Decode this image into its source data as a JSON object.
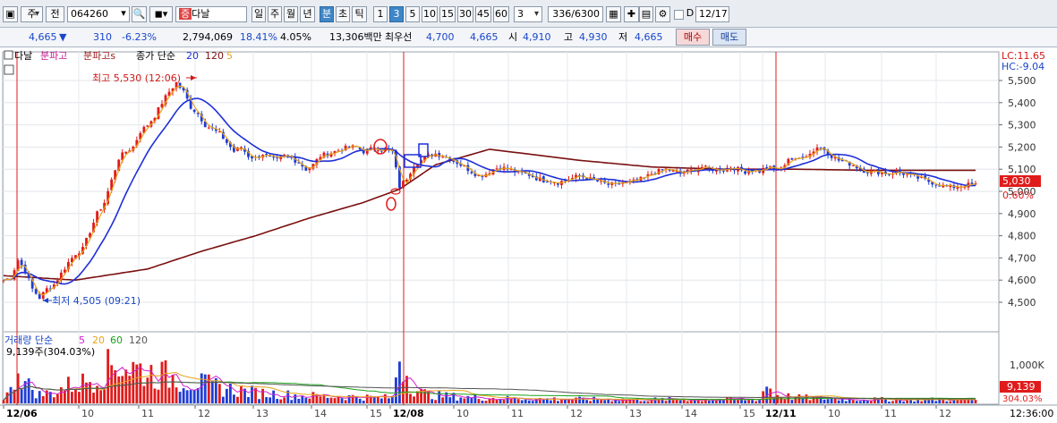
{
  "toolbar": {
    "market_label": "주",
    "prev_label": "전",
    "code": "064260",
    "stock_name": "다날",
    "name_badge": "증",
    "period_buttons": [
      "일",
      "주",
      "월",
      "년",
      "분",
      "초",
      "틱"
    ],
    "interval_buttons": [
      "1",
      "3",
      "5",
      "10",
      "15",
      "30",
      "45",
      "60"
    ],
    "interval_select": "3",
    "count_display": "336/6300",
    "date_checkbox_label": "D",
    "date": "12/17"
  },
  "quote": {
    "price": "4,665",
    "change_arrow": "▼",
    "change": "310",
    "change_pct": "-6.23%",
    "volume": "2,794,069",
    "vol_ratio": "18.41%",
    "turnover": "4.05%",
    "amount": "13,306백만",
    "best_label": "최우선",
    "ask": "4,700",
    "bid": "4,665",
    "open_label": "시",
    "open": "4,910",
    "high_label": "고",
    "high": "4,930",
    "low_label": "저",
    "low": "4,665",
    "buy_label": "매수",
    "sell_label": "매도"
  },
  "legend": {
    "item1": "다날",
    "item2": "분파고",
    "item3": "분파고s",
    "ma_label": "종가 단순",
    "ma_periods": [
      "20",
      "120",
      "5"
    ],
    "lc_label": "LC:11.65",
    "hc_label": "HC:-9.04",
    "vol_title": "거래량 단순",
    "vol_periods": [
      "5",
      "20",
      "60",
      "120"
    ],
    "vol_current": "9,139주(304.03%)"
  },
  "annotations": {
    "high": "최고 5,530 (12:06)",
    "low": "최저 4,505 (09:21)"
  },
  "colors": {
    "up": "#e01b1b",
    "down": "#1f3cd4",
    "ma5": "#e8a317",
    "ma20": "#1e2fd8",
    "ma120": "#7a1010",
    "vol_ma5": "#d020d0",
    "vol_ma20": "#e8a317",
    "vol_ma60": "#1aa01a",
    "vol_ma120": "#555555",
    "accent_toolbar": "#3f86c7"
  },
  "chart_data": {
    "type": "candlestick",
    "interval": "3분",
    "y_ticks": [
      "5,500",
      "5,400",
      "5,300",
      "5,200",
      "5,100",
      "5,000",
      "4,900",
      "4,800",
      "4,700",
      "4,600",
      "4,500"
    ],
    "ylim": [
      4440,
      5590
    ],
    "price_tag": "5,030",
    "price_tag_pct": "0.60%",
    "volume_tick": "1,000K",
    "volume_tag": "9,139",
    "volume_tag_pct": "304.03%",
    "time_label": "12:36:00",
    "x_labels": [
      "12/06",
      "10",
      "11",
      "12",
      "13",
      "14",
      "15",
      "12/08",
      "10",
      "11",
      "12",
      "13",
      "14",
      "15",
      "12/11",
      "10",
      "11",
      "12"
    ],
    "x_label_hours": [
      9,
      10,
      11,
      12,
      13,
      14,
      15,
      9,
      10,
      11,
      12,
      13,
      14,
      15,
      9,
      10,
      11,
      12
    ],
    "date_boundaries": [
      "12/06",
      "12/08",
      "12/11"
    ],
    "series": [
      {
        "name": "5",
        "indicator": "ma5"
      },
      {
        "name": "20",
        "indicator": "ma20"
      },
      {
        "name": "120",
        "indicator": "ma120"
      }
    ],
    "close_path": [
      [
        0,
        4600
      ],
      [
        2,
        4610
      ],
      [
        4,
        4690
      ],
      [
        6,
        4640
      ],
      [
        8,
        4560
      ],
      [
        10,
        4520
      ],
      [
        12,
        4560
      ],
      [
        14,
        4580
      ],
      [
        16,
        4630
      ],
      [
        18,
        4680
      ],
      [
        20,
        4720
      ],
      [
        22,
        4740
      ],
      [
        24,
        4820
      ],
      [
        26,
        4900
      ],
      [
        28,
        4950
      ],
      [
        30,
        5050
      ],
      [
        32,
        5150
      ],
      [
        34,
        5180
      ],
      [
        36,
        5200
      ],
      [
        38,
        5270
      ],
      [
        40,
        5300
      ],
      [
        42,
        5340
      ],
      [
        44,
        5400
      ],
      [
        46,
        5450
      ],
      [
        48,
        5490
      ],
      [
        50,
        5450
      ],
      [
        52,
        5380
      ],
      [
        54,
        5350
      ],
      [
        56,
        5300
      ],
      [
        58,
        5280
      ],
      [
        60,
        5260
      ],
      [
        62,
        5220
      ],
      [
        64,
        5180
      ],
      [
        66,
        5200
      ],
      [
        68,
        5160
      ],
      [
        70,
        5150
      ],
      [
        72,
        5170
      ],
      [
        74,
        5150
      ],
      [
        76,
        5140
      ],
      [
        78,
        5160
      ],
      [
        80,
        5150
      ],
      [
        82,
        5130
      ],
      [
        84,
        5100
      ],
      [
        86,
        5120
      ],
      [
        88,
        5160
      ],
      [
        90,
        5170
      ],
      [
        92,
        5180
      ],
      [
        94,
        5190
      ],
      [
        96,
        5200
      ],
      [
        98,
        5200
      ],
      [
        100,
        5180
      ],
      [
        102,
        5190
      ],
      [
        104,
        5195
      ],
      [
        106,
        5185
      ],
      [
        108,
        5180
      ],
      [
        110,
        5020
      ],
      [
        112,
        5060
      ],
      [
        114,
        5120
      ],
      [
        116,
        5140
      ],
      [
        118,
        5160
      ],
      [
        120,
        5170
      ],
      [
        122,
        5160
      ],
      [
        124,
        5150
      ],
      [
        126,
        5130
      ],
      [
        128,
        5110
      ],
      [
        130,
        5090
      ],
      [
        132,
        5070
      ],
      [
        134,
        5080
      ],
      [
        136,
        5100
      ],
      [
        138,
        5110
      ],
      [
        140,
        5100
      ],
      [
        142,
        5090
      ],
      [
        144,
        5080
      ],
      [
        146,
        5075
      ],
      [
        148,
        5060
      ],
      [
        150,
        5050
      ],
      [
        152,
        5050
      ],
      [
        154,
        5040
      ],
      [
        156,
        5050
      ],
      [
        158,
        5060
      ],
      [
        160,
        5070
      ],
      [
        162,
        5060
      ],
      [
        164,
        5050
      ],
      [
        166,
        5040
      ],
      [
        168,
        5030
      ],
      [
        170,
        5030
      ],
      [
        172,
        5040
      ],
      [
        174,
        5040
      ],
      [
        176,
        5050
      ],
      [
        178,
        5060
      ],
      [
        180,
        5080
      ],
      [
        182,
        5090
      ],
      [
        184,
        5100
      ],
      [
        186,
        5090
      ],
      [
        188,
        5080
      ],
      [
        190,
        5090
      ],
      [
        192,
        5100
      ],
      [
        194,
        5110
      ],
      [
        196,
        5100
      ],
      [
        198,
        5100
      ],
      [
        200,
        5100
      ],
      [
        202,
        5110
      ],
      [
        204,
        5100
      ],
      [
        206,
        5090
      ],
      [
        208,
        5100
      ],
      [
        210,
        5090
      ],
      [
        212,
        5110
      ],
      [
        214,
        5100
      ],
      [
        216,
        5100
      ],
      [
        218,
        5150
      ],
      [
        220,
        5140
      ],
      [
        222,
        5160
      ],
      [
        224,
        5170
      ],
      [
        226,
        5200
      ],
      [
        228,
        5190
      ],
      [
        230,
        5160
      ],
      [
        232,
        5140
      ],
      [
        234,
        5130
      ],
      [
        236,
        5120
      ],
      [
        238,
        5100
      ],
      [
        240,
        5090
      ],
      [
        242,
        5090
      ],
      [
        244,
        5085
      ],
      [
        246,
        5080
      ],
      [
        248,
        5090
      ],
      [
        250,
        5080
      ],
      [
        252,
        5070
      ],
      [
        254,
        5060
      ],
      [
        256,
        5050
      ],
      [
        258,
        5040
      ],
      [
        260,
        5030
      ],
      [
        262,
        5020
      ],
      [
        264,
        5020
      ],
      [
        266,
        5025
      ],
      [
        268,
        5030
      ],
      [
        270,
        5030
      ]
    ],
    "ma120_path": [
      [
        0,
        4620
      ],
      [
        20,
        4600
      ],
      [
        40,
        4650
      ],
      [
        55,
        4730
      ],
      [
        70,
        4800
      ],
      [
        85,
        4880
      ],
      [
        100,
        4950
      ],
      [
        110,
        5010
      ],
      [
        120,
        5120
      ],
      [
        135,
        5190
      ],
      [
        145,
        5170
      ],
      [
        160,
        5140
      ],
      [
        180,
        5110
      ],
      [
        200,
        5100
      ],
      [
        220,
        5100
      ],
      [
        240,
        5095
      ],
      [
        260,
        5095
      ],
      [
        270,
        5095
      ]
    ],
    "volume_profile": [
      [
        0,
        60
      ],
      [
        2,
        120
      ],
      [
        4,
        400
      ],
      [
        6,
        200
      ],
      [
        8,
        150
      ],
      [
        10,
        90
      ],
      [
        12,
        100
      ],
      [
        14,
        110
      ],
      [
        16,
        150
      ],
      [
        18,
        180
      ],
      [
        20,
        190
      ],
      [
        22,
        210
      ],
      [
        24,
        250
      ],
      [
        26,
        280
      ],
      [
        28,
        320
      ],
      [
        30,
        380
      ],
      [
        32,
        420
      ],
      [
        34,
        380
      ],
      [
        36,
        360
      ],
      [
        38,
        340
      ],
      [
        40,
        320
      ],
      [
        42,
        300
      ],
      [
        44,
        290
      ],
      [
        46,
        270
      ],
      [
        48,
        260
      ],
      [
        50,
        240
      ],
      [
        52,
        220
      ],
      [
        54,
        210
      ],
      [
        56,
        190
      ],
      [
        58,
        180
      ],
      [
        60,
        160
      ],
      [
        62,
        150
      ],
      [
        64,
        140
      ],
      [
        66,
        130
      ],
      [
        68,
        120
      ],
      [
        70,
        110
      ],
      [
        72,
        105
      ],
      [
        74,
        100
      ],
      [
        76,
        95
      ],
      [
        78,
        90
      ],
      [
        80,
        85
      ],
      [
        82,
        80
      ],
      [
        84,
        78
      ],
      [
        86,
        76
      ],
      [
        88,
        74
      ],
      [
        90,
        72
      ],
      [
        92,
        70
      ],
      [
        94,
        70
      ],
      [
        96,
        68
      ],
      [
        98,
        66
      ],
      [
        100,
        64
      ],
      [
        102,
        62
      ],
      [
        104,
        60
      ],
      [
        106,
        60
      ],
      [
        108,
        60
      ],
      [
        110,
        520
      ],
      [
        112,
        300
      ],
      [
        114,
        160
      ],
      [
        116,
        110
      ],
      [
        118,
        90
      ],
      [
        120,
        80
      ],
      [
        130,
        60
      ],
      [
        140,
        50
      ],
      [
        150,
        45
      ],
      [
        160,
        42
      ],
      [
        170,
        40
      ],
      [
        180,
        40
      ],
      [
        190,
        40
      ],
      [
        200,
        40
      ],
      [
        210,
        40
      ],
      [
        212,
        200
      ],
      [
        214,
        90
      ],
      [
        220,
        60
      ],
      [
        230,
        50
      ],
      [
        240,
        40
      ],
      [
        250,
        40
      ],
      [
        260,
        38
      ],
      [
        270,
        38
      ]
    ]
  }
}
